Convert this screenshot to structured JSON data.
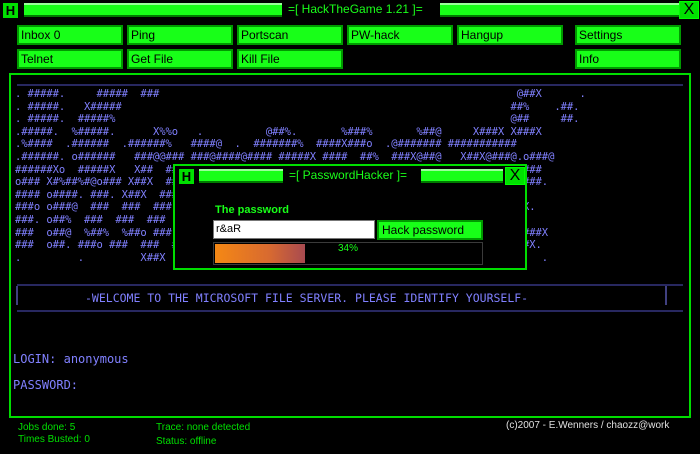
{
  "window": {
    "title": "=[ HackTheGame 1.21 ]=",
    "logo_letter": "H",
    "close_label": "X"
  },
  "menu": {
    "inbox": "Inbox 0",
    "ping": "Ping",
    "portscan": "Portscan",
    "pwhack": "PW-hack",
    "hangup": "Hangup",
    "settings": "Settings",
    "telnet": "Telnet",
    "getfile": "Get File",
    "killfile": "Kill File",
    "info": "Info"
  },
  "terminal": {
    "ascii_art": ". #####.     #####  ###                                                         @##X      .\n. #####.   X#####                                                              ##%    .##.\n. #####.  #####%                                                               @##     ##.\n.#####.  %#####.      X%%o   .          @##%.       %###%       %##@     X###X X###X\n.%####  .######  .######%   ####@  .  #######%  ####X###o  .@####### ###########\n.######. o######   ###@@### ###@####@#### #####X ####  ##%  ###X@##@   X##X@###@.o###@\n######Xo  #####X   X##  ###X  ###  @##  ###  ##@ X##X  @##.####  ###  X##X  ###  ###\no### X#%##%#@o### X##X  ###o  ###  X##  ###  ##@ X##@ .###  ###  ###  X##X  ###  ###.\n#### o####. ###. X##X  ###  ###  X##  ###  ##@ X##@ ###  ###  ###  ###  ###  X##%.\n###o o###@  ###  ###  ###  ###  X##  ###  ##@ X##X ###  ###  ###  X##X #X@  #####X.\n###. o##%  ###  ###  ###  ###  X##  ###  ##@ X##X ###  ###  ###  X##X .o##X  .##.\n###  o##@  %##%  %##o ###  ###  X##  ###  ##@  ###  ###  ###X  %##X  %##  ###X  X###X\n###  o##. ###o ###  ###  ###  X##  ###  ##@  ###  ###  ###X  ###X  ###X  ###  X###X.\n.         .         X##X                                          X##X          .   .",
    "welcome": "-WELCOME TO THE MICROSOFT FILE SERVER. PLEASE IDENTIFY YOURSELF-",
    "login_label": "LOGIN:",
    "login_value": "anonymous",
    "password_label": "PASSWORD:"
  },
  "dialog": {
    "title": "=[ PasswordHacker ]=",
    "logo_letter": "H",
    "close_label": "X",
    "field_label": "The password",
    "password_value": "r&aR",
    "button_label": "Hack password",
    "progress_percent": 34,
    "progress_text": "34%"
  },
  "status": {
    "jobs_done": "Jobs done: 5",
    "times_busted": "Times Busted: 0",
    "trace": "Trace: none detected",
    "status": "Status: offline",
    "credits": "(c)2007 - E.Wenners / chaozz@work"
  },
  "colors": {
    "accent_green": "#18ff18",
    "text_purple": "#8080ff",
    "background": "#000000"
  }
}
